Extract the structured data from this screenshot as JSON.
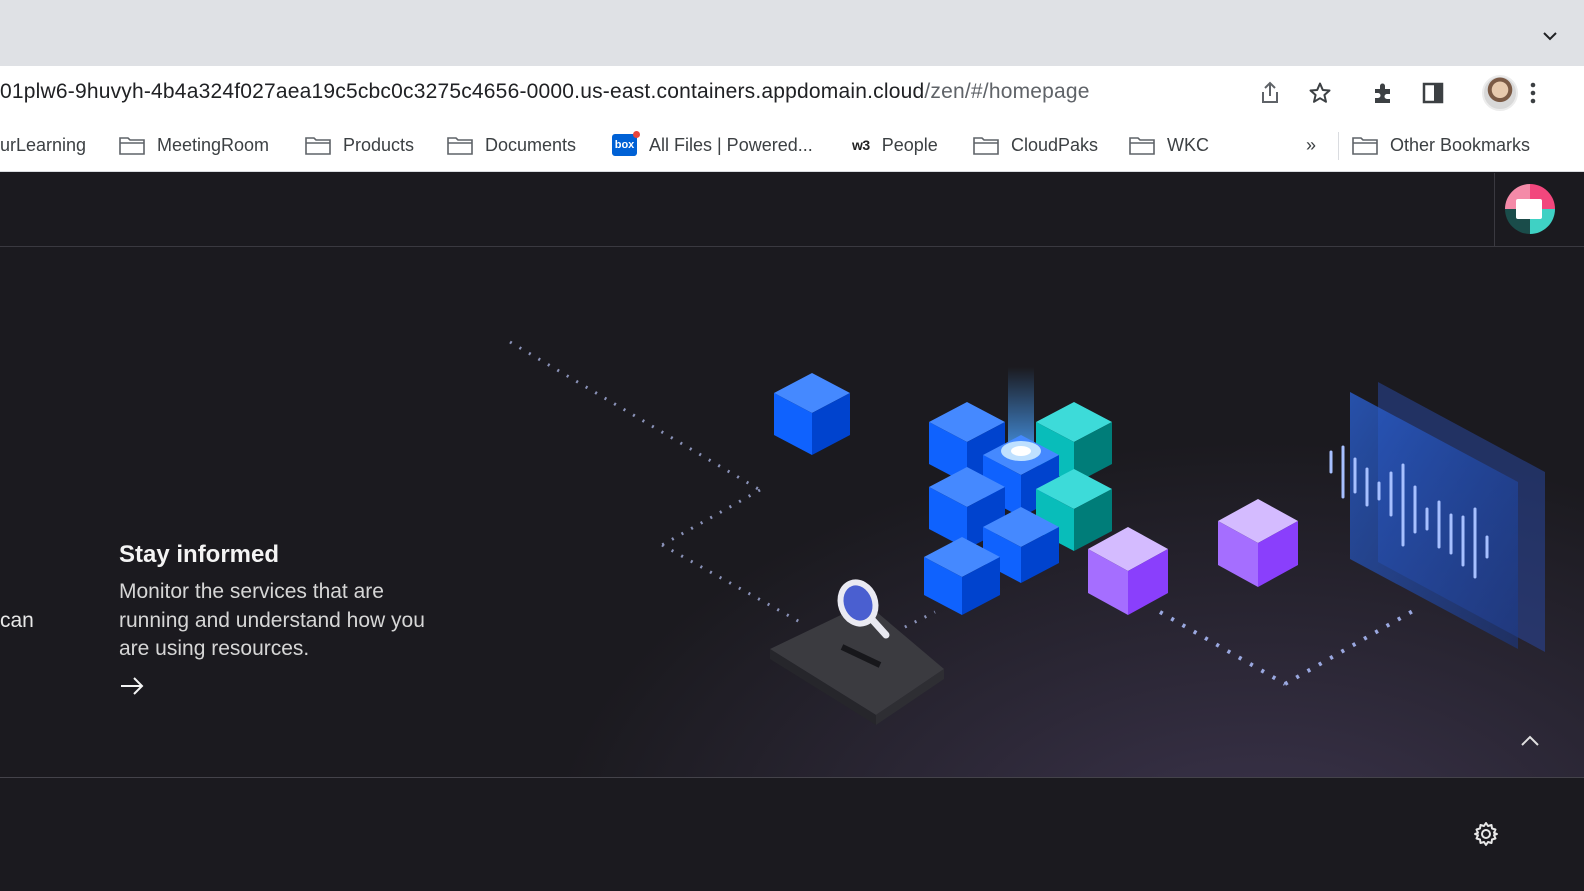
{
  "browser": {
    "url_main": "01plw6-9huvyh-4b4a324f027aea19c5cbc0c3275c4656-0000.us-east.containers.appdomain.cloud",
    "url_path": "/zen/#/homepage",
    "bookmarks": [
      {
        "label": "urLearning",
        "icon": "none"
      },
      {
        "label": "MeetingRoom",
        "icon": "folder-icon"
      },
      {
        "label": "Products",
        "icon": "folder-icon"
      },
      {
        "label": "Documents",
        "icon": "folder-icon"
      },
      {
        "label": "All Files | Powered...",
        "icon": "box-icon"
      },
      {
        "label": "People",
        "icon": "w3-icon"
      },
      {
        "label": "CloudPaks",
        "icon": "folder-icon"
      },
      {
        "label": "WKC",
        "icon": "folder-icon"
      }
    ],
    "overflow_label": "»",
    "other_bookmarks": "Other Bookmarks",
    "box_icon_text": "box",
    "w3_icon_text": "w3"
  },
  "hero": {
    "left_fragment": "can",
    "card": {
      "title": "Stay informed",
      "description": "Monitor the services that are running and understand how you are using resources."
    }
  },
  "colors": {
    "background": "#1b1a1f",
    "cube_blue": "#0f62fe",
    "cube_teal": "#08bdba",
    "cube_purple": "#a56eff"
  }
}
